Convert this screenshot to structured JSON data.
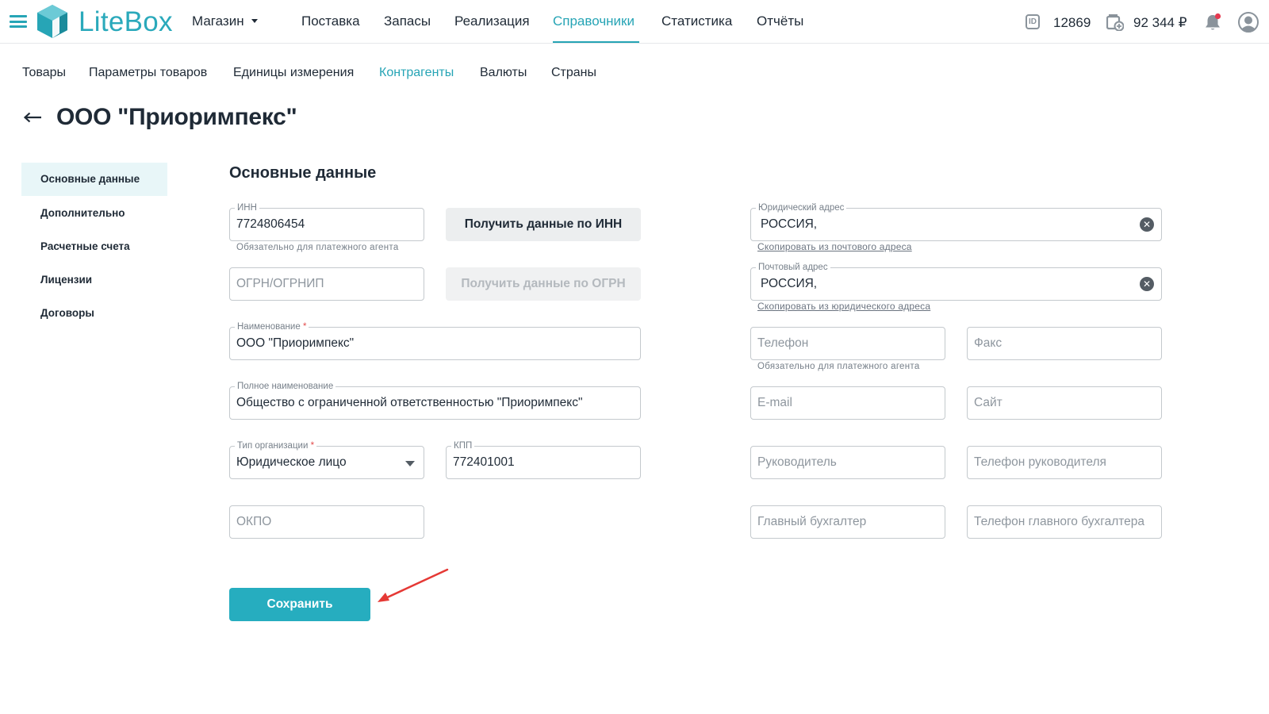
{
  "header": {
    "logo_text": "LiteBox",
    "store": "Магазин",
    "nav": [
      "Поставка",
      "Запасы",
      "Реализация",
      "Справочники",
      "Статистика",
      "Отчёты"
    ],
    "active_nav": "Справочники",
    "id_badge": "ID",
    "account_id": "12869",
    "balance": "92 344 ₽"
  },
  "subnav": {
    "items": [
      "Товары",
      "Параметры товаров",
      "Единицы измерения",
      "Контрагенты",
      "Валюты",
      "Страны"
    ],
    "active": "Контрагенты"
  },
  "page": {
    "back_glyph": "←",
    "title": "ООО \"Приоримпекс\""
  },
  "sidebar": {
    "items": [
      "Основные данные",
      "Дополнительно",
      "Расчетные счета",
      "Лицензии",
      "Договоры"
    ],
    "active": "Основные данные"
  },
  "form": {
    "section_title": "Основные данные",
    "inn": {
      "label": "ИНН",
      "value": "7724806454",
      "helper": "Обязательно для платежного агента"
    },
    "get_by_inn_button": "Получить данные по ИНН",
    "ogrn": {
      "placeholder": "ОГРН/ОГРНИП"
    },
    "get_by_ogrn_button": "Получить данные по ОГРН",
    "name": {
      "label": "Наименование",
      "required_mark": "*",
      "value": "ООО \"Приоримпекс\""
    },
    "full_name": {
      "label": "Полное наименование",
      "value": "Общество с ограниченной ответственностью \"Приоримпекс\""
    },
    "org_type": {
      "label": "Тип организации",
      "required_mark": "*",
      "value": "Юридическое лицо"
    },
    "kpp": {
      "label": "КПП",
      "value": "772401001"
    },
    "okpo": {
      "placeholder": "ОКПО"
    },
    "legal_address": {
      "label": "Юридический адрес",
      "value": "РОССИЯ,",
      "link": "Скопировать из почтового адреса"
    },
    "postal_address": {
      "label": "Почтовый адрес",
      "value": "РОССИЯ,",
      "link": "Скопировать из юридического адреса"
    },
    "phone": {
      "placeholder": "Телефон",
      "helper": "Обязательно для платежного агента"
    },
    "fax": {
      "placeholder": "Факс"
    },
    "email": {
      "placeholder": "E-mail"
    },
    "site": {
      "placeholder": "Сайт"
    },
    "director": {
      "placeholder": "Руководитель"
    },
    "director_phone": {
      "placeholder": "Телефон руководителя"
    },
    "accountant": {
      "placeholder": "Главный бухгалтер"
    },
    "accountant_phone": {
      "placeholder": "Телефон главного бухгалтера"
    },
    "clear_glyph": "✕",
    "save_button": "Сохранить"
  },
  "colors": {
    "accent": "#26a4b5",
    "save_button": "#26adbf",
    "annotation_arrow": "#e53935",
    "notification_dot": "#e53950"
  },
  "icons": [
    "menu-icon",
    "litebox-logo-icon",
    "id-icon",
    "wallet-icon",
    "bell-icon",
    "user-avatar-icon",
    "back-arrow-icon",
    "clear-icon",
    "chevron-down-icon",
    "annotation-arrow"
  ]
}
